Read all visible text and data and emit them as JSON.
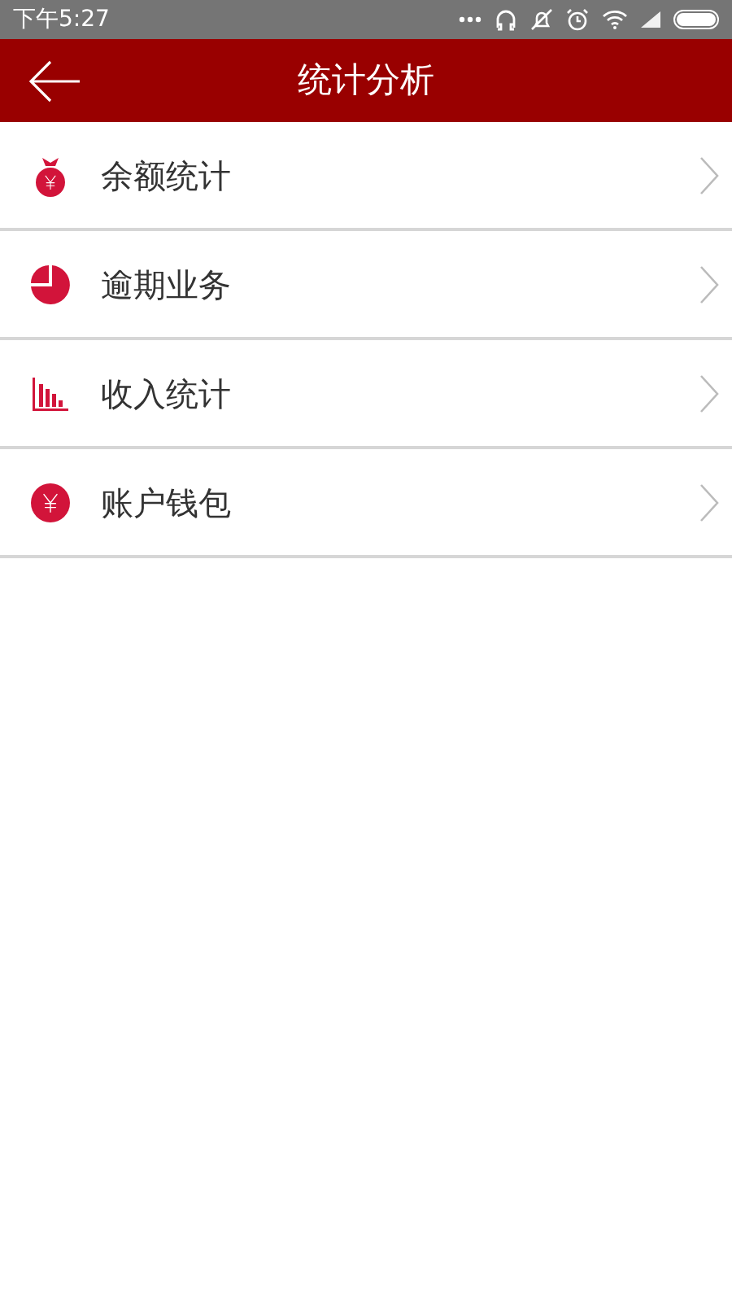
{
  "status_bar": {
    "time": "下午5:27"
  },
  "header": {
    "title": "统计分析"
  },
  "menu": [
    {
      "kind": "bag",
      "label": "余额统计"
    },
    {
      "kind": "pie",
      "label": "逾期业务"
    },
    {
      "kind": "bars",
      "label": "收入统计"
    },
    {
      "kind": "yen",
      "label": "账户钱包"
    }
  ]
}
